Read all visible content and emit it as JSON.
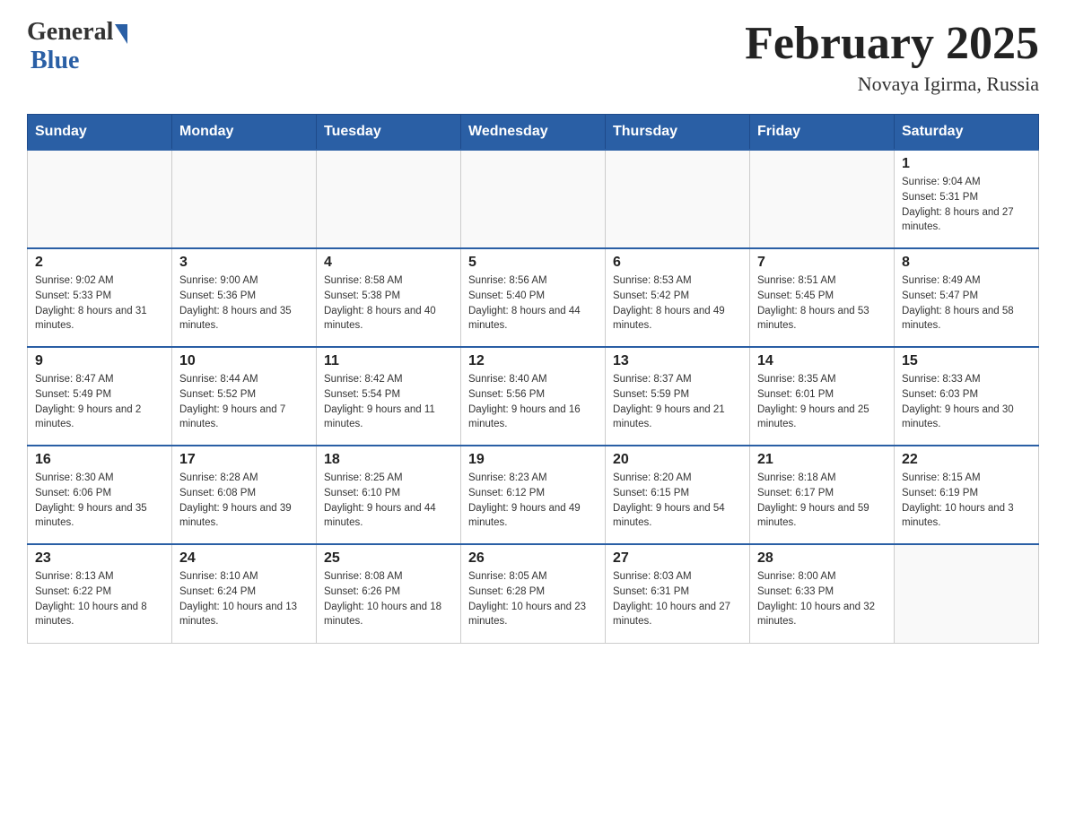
{
  "header": {
    "logo_general": "General",
    "logo_blue": "Blue",
    "month_title": "February 2025",
    "location": "Novaya Igirma, Russia"
  },
  "days_of_week": [
    "Sunday",
    "Monday",
    "Tuesday",
    "Wednesday",
    "Thursday",
    "Friday",
    "Saturday"
  ],
  "weeks": [
    [
      {
        "day": "",
        "info": ""
      },
      {
        "day": "",
        "info": ""
      },
      {
        "day": "",
        "info": ""
      },
      {
        "day": "",
        "info": ""
      },
      {
        "day": "",
        "info": ""
      },
      {
        "day": "",
        "info": ""
      },
      {
        "day": "1",
        "info": "Sunrise: 9:04 AM\nSunset: 5:31 PM\nDaylight: 8 hours and 27 minutes."
      }
    ],
    [
      {
        "day": "2",
        "info": "Sunrise: 9:02 AM\nSunset: 5:33 PM\nDaylight: 8 hours and 31 minutes."
      },
      {
        "day": "3",
        "info": "Sunrise: 9:00 AM\nSunset: 5:36 PM\nDaylight: 8 hours and 35 minutes."
      },
      {
        "day": "4",
        "info": "Sunrise: 8:58 AM\nSunset: 5:38 PM\nDaylight: 8 hours and 40 minutes."
      },
      {
        "day": "5",
        "info": "Sunrise: 8:56 AM\nSunset: 5:40 PM\nDaylight: 8 hours and 44 minutes."
      },
      {
        "day": "6",
        "info": "Sunrise: 8:53 AM\nSunset: 5:42 PM\nDaylight: 8 hours and 49 minutes."
      },
      {
        "day": "7",
        "info": "Sunrise: 8:51 AM\nSunset: 5:45 PM\nDaylight: 8 hours and 53 minutes."
      },
      {
        "day": "8",
        "info": "Sunrise: 8:49 AM\nSunset: 5:47 PM\nDaylight: 8 hours and 58 minutes."
      }
    ],
    [
      {
        "day": "9",
        "info": "Sunrise: 8:47 AM\nSunset: 5:49 PM\nDaylight: 9 hours and 2 minutes."
      },
      {
        "day": "10",
        "info": "Sunrise: 8:44 AM\nSunset: 5:52 PM\nDaylight: 9 hours and 7 minutes."
      },
      {
        "day": "11",
        "info": "Sunrise: 8:42 AM\nSunset: 5:54 PM\nDaylight: 9 hours and 11 minutes."
      },
      {
        "day": "12",
        "info": "Sunrise: 8:40 AM\nSunset: 5:56 PM\nDaylight: 9 hours and 16 minutes."
      },
      {
        "day": "13",
        "info": "Sunrise: 8:37 AM\nSunset: 5:59 PM\nDaylight: 9 hours and 21 minutes."
      },
      {
        "day": "14",
        "info": "Sunrise: 8:35 AM\nSunset: 6:01 PM\nDaylight: 9 hours and 25 minutes."
      },
      {
        "day": "15",
        "info": "Sunrise: 8:33 AM\nSunset: 6:03 PM\nDaylight: 9 hours and 30 minutes."
      }
    ],
    [
      {
        "day": "16",
        "info": "Sunrise: 8:30 AM\nSunset: 6:06 PM\nDaylight: 9 hours and 35 minutes."
      },
      {
        "day": "17",
        "info": "Sunrise: 8:28 AM\nSunset: 6:08 PM\nDaylight: 9 hours and 39 minutes."
      },
      {
        "day": "18",
        "info": "Sunrise: 8:25 AM\nSunset: 6:10 PM\nDaylight: 9 hours and 44 minutes."
      },
      {
        "day": "19",
        "info": "Sunrise: 8:23 AM\nSunset: 6:12 PM\nDaylight: 9 hours and 49 minutes."
      },
      {
        "day": "20",
        "info": "Sunrise: 8:20 AM\nSunset: 6:15 PM\nDaylight: 9 hours and 54 minutes."
      },
      {
        "day": "21",
        "info": "Sunrise: 8:18 AM\nSunset: 6:17 PM\nDaylight: 9 hours and 59 minutes."
      },
      {
        "day": "22",
        "info": "Sunrise: 8:15 AM\nSunset: 6:19 PM\nDaylight: 10 hours and 3 minutes."
      }
    ],
    [
      {
        "day": "23",
        "info": "Sunrise: 8:13 AM\nSunset: 6:22 PM\nDaylight: 10 hours and 8 minutes."
      },
      {
        "day": "24",
        "info": "Sunrise: 8:10 AM\nSunset: 6:24 PM\nDaylight: 10 hours and 13 minutes."
      },
      {
        "day": "25",
        "info": "Sunrise: 8:08 AM\nSunset: 6:26 PM\nDaylight: 10 hours and 18 minutes."
      },
      {
        "day": "26",
        "info": "Sunrise: 8:05 AM\nSunset: 6:28 PM\nDaylight: 10 hours and 23 minutes."
      },
      {
        "day": "27",
        "info": "Sunrise: 8:03 AM\nSunset: 6:31 PM\nDaylight: 10 hours and 27 minutes."
      },
      {
        "day": "28",
        "info": "Sunrise: 8:00 AM\nSunset: 6:33 PM\nDaylight: 10 hours and 32 minutes."
      },
      {
        "day": "",
        "info": ""
      }
    ]
  ]
}
